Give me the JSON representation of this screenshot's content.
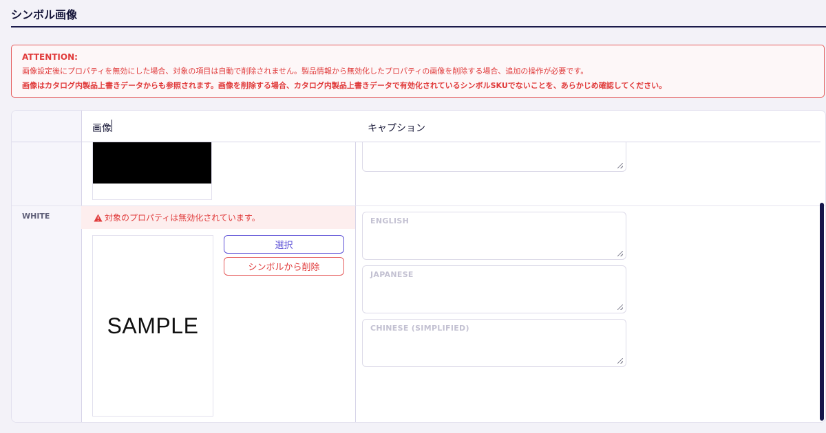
{
  "section": {
    "title": "シンボル画像"
  },
  "attention": {
    "heading": "ATTENTION:",
    "line1": "画像設定後にプロパティを無効にした場合、対象の項目は自動で削除されません。製品情報から無効化したプロパティの画像を削除する場合、追加の操作が必要です。",
    "line2": "画像はカタログ内製品上書きデータからも参照されます。画像を削除する場合、カタログ内製品上書きデータで有効化されているシンボルSKUでないことを、あらかじめ確認してください。"
  },
  "table": {
    "headers": {
      "image": "画像",
      "caption": "キャプション"
    },
    "rows": [
      {
        "label": "",
        "image": "black",
        "caption_value": ""
      },
      {
        "label": "WHITE",
        "warning": "対象のプロパティは無効化されています。",
        "image_text": "SAMPLE",
        "select_label": "選択",
        "delete_label": "シンボルから削除",
        "captions": [
          {
            "placeholder": "ENGLISH",
            "value": ""
          },
          {
            "placeholder": "JAPANESE",
            "value": ""
          },
          {
            "placeholder": "CHINESE (SIMPLIFIED)",
            "value": ""
          }
        ]
      }
    ]
  },
  "icons": {
    "warning": "warning-triangle-icon",
    "resize": "resize-grip-icon"
  },
  "colors": {
    "accent": "#5b4fd6",
    "danger": "#e03b3b",
    "navy": "#1b1b4b"
  }
}
